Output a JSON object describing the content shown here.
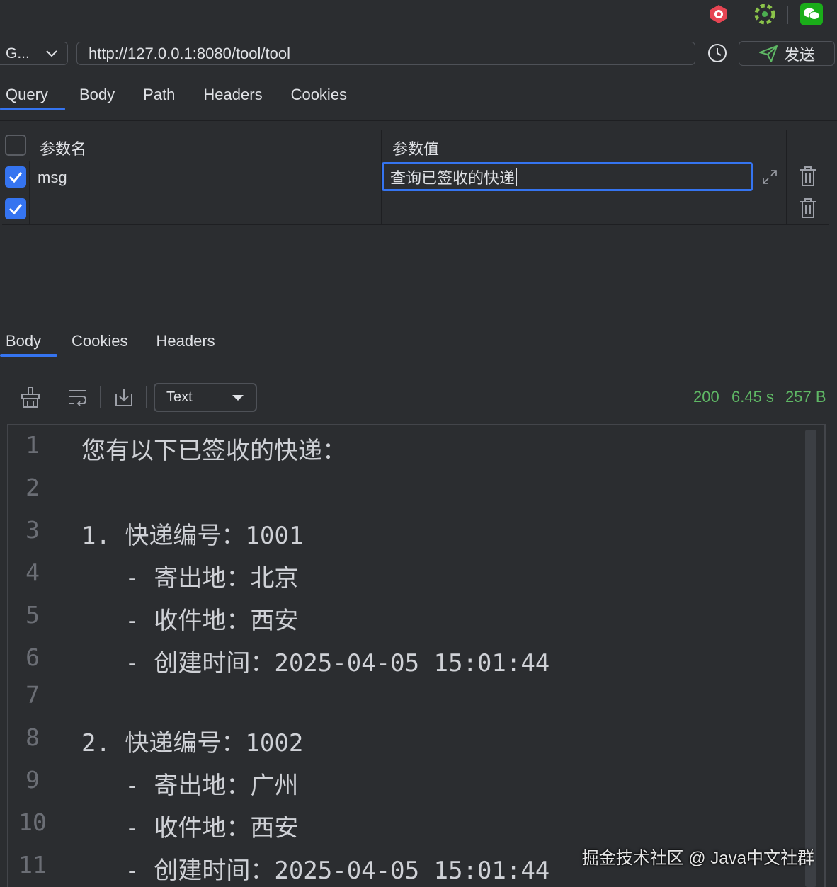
{
  "request": {
    "method": "G...",
    "url": "http://127.0.0.1:8080/tool/tool",
    "send_label": "发送"
  },
  "request_tabs": [
    "Query",
    "Body",
    "Path",
    "Headers",
    "Cookies"
  ],
  "params": {
    "header_name": "参数名",
    "header_value": "参数值",
    "rows": [
      {
        "name": "msg",
        "value": "查询已签收的快递"
      },
      {
        "name": "",
        "value": ""
      }
    ]
  },
  "response_tabs": [
    "Body",
    "Cookies",
    "Headers"
  ],
  "response": {
    "format": "Text",
    "status_code": "200",
    "time": "6.45 s",
    "size": "257 B",
    "lines": [
      {
        "num": "1",
        "text": "您有以下已签收的快递："
      },
      {
        "num": "2",
        "text": ""
      },
      {
        "num": "3",
        "text": "1. 快递编号：1001"
      },
      {
        "num": "4",
        "text": "   - 寄出地：北京"
      },
      {
        "num": "5",
        "text": "   - 收件地：西安"
      },
      {
        "num": "6",
        "text": "   - 创建时间：2025-04-05 15:01:44"
      },
      {
        "num": "7",
        "text": ""
      },
      {
        "num": "8",
        "text": "2. 快递编号：1002"
      },
      {
        "num": "9",
        "text": "   - 寄出地：广州"
      },
      {
        "num": "10",
        "text": "   - 收件地：西安"
      },
      {
        "num": "11",
        "text": "   - 创建时间：2025-04-05 15:01:44"
      }
    ]
  },
  "watermark": "掘金技术社区 @ Java中文社群",
  "colors": {
    "accent": "#3574f0",
    "status_ok": "#5fb865",
    "background": "#2b2d30"
  },
  "icons": [
    "app-red-icon",
    "app-green-wheel-icon",
    "wechat-icon",
    "chevron-down-icon",
    "history-icon",
    "send-icon",
    "expand-icon",
    "trash-icon",
    "clear-icon",
    "wrap-icon",
    "download-icon",
    "dropdown-arrow-icon"
  ]
}
